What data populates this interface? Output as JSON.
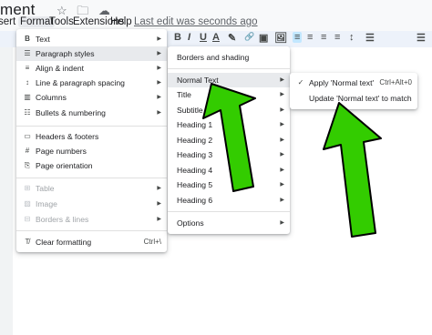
{
  "header": {
    "doc_title": "ment",
    "icons": [
      "star-icon",
      "folder-icon",
      "cloud-icon"
    ]
  },
  "menubar": {
    "items": [
      "sert",
      "Format",
      "Tools",
      "Extensions",
      "Help"
    ],
    "last_edit": "Last edit was seconds ago"
  },
  "toolbar": {
    "buttons": [
      "B",
      "I",
      "U",
      "A",
      "✎",
      "🔗",
      "▣",
      "🖼",
      "≡",
      "≡",
      "≡",
      "≡",
      "↕",
      "☰",
      "☰"
    ]
  },
  "format_menu": {
    "items": [
      {
        "icon": "B",
        "label": "Text",
        "arrow": "▶"
      },
      {
        "icon": "☰",
        "label": "Paragraph styles",
        "arrow": "▶"
      },
      {
        "icon": "≡",
        "label": "Align & indent",
        "arrow": "▶"
      },
      {
        "icon": "↕",
        "label": "Line & paragraph spacing",
        "arrow": "▶"
      },
      {
        "icon": "▥",
        "label": "Columns",
        "arrow": "▶"
      },
      {
        "icon": "☷",
        "label": "Bullets & numbering",
        "arrow": "▶"
      },
      {
        "icon": "▭",
        "label": "Headers & footers",
        "arrow": ""
      },
      {
        "icon": "#",
        "label": "Page numbers",
        "arrow": ""
      },
      {
        "icon": "⎘",
        "label": "Page orientation",
        "arrow": ""
      },
      {
        "icon": "⊞",
        "label": "Table",
        "arrow": "▶"
      },
      {
        "icon": "▨",
        "label": "Image",
        "arrow": "▶"
      },
      {
        "icon": "⊟",
        "label": "Borders & lines",
        "arrow": "▶"
      },
      {
        "icon": "T̸",
        "label": "Clear formatting",
        "shortcut": "Ctrl+\\"
      }
    ]
  },
  "styles_menu": {
    "items": [
      {
        "label": "Borders and shading",
        "arrow": ""
      },
      {
        "label": "Normal Text",
        "arrow": "▶"
      },
      {
        "label": "Title",
        "arrow": "▶"
      },
      {
        "label": "Subtitle",
        "arrow": "▶"
      },
      {
        "label": "Heading 1",
        "arrow": "▶"
      },
      {
        "label": "Heading 2",
        "arrow": "▶"
      },
      {
        "label": "Heading 3",
        "arrow": "▶"
      },
      {
        "label": "Heading 4",
        "arrow": "▶"
      },
      {
        "label": "Heading 5",
        "arrow": "▶"
      },
      {
        "label": "Heading 6",
        "arrow": "▶"
      },
      {
        "label": "Options",
        "arrow": "▶"
      }
    ]
  },
  "normal_text_menu": {
    "items": [
      {
        "icon": "✓",
        "label": "Apply 'Normal text'",
        "shortcut": "Ctrl+Alt+0"
      },
      {
        "icon": "",
        "label": "Update 'Normal text' to match",
        "shortcut": ""
      }
    ]
  },
  "annotation": {
    "arrow_color": "#33cc00",
    "arrow_outline": "#000000"
  }
}
